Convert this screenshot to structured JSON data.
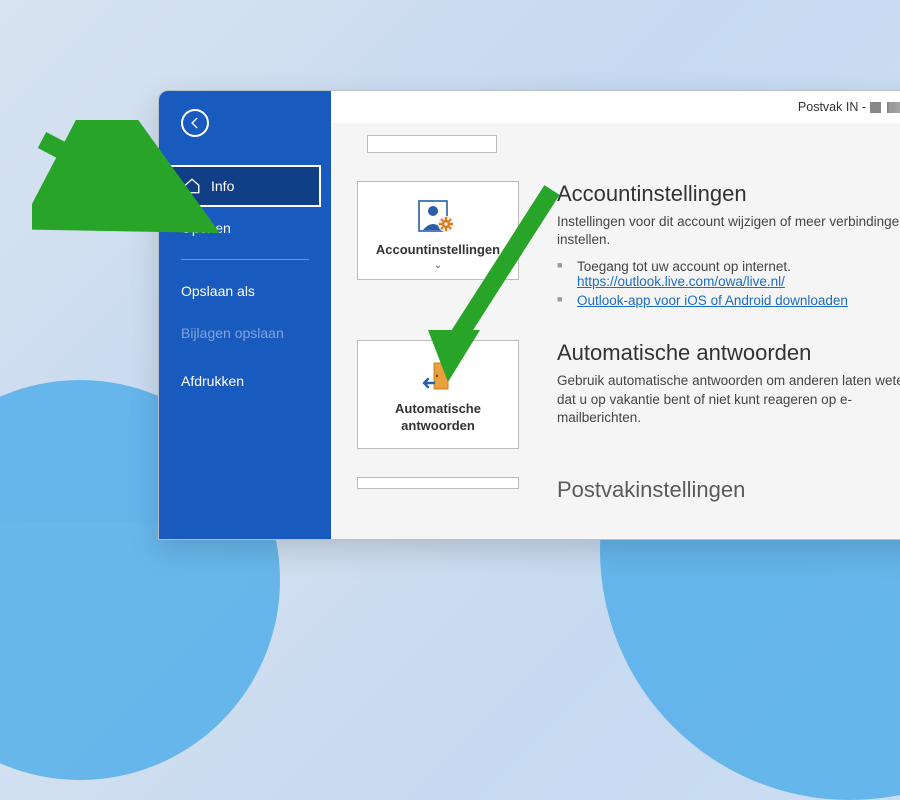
{
  "titlebar": {
    "label": "Postvak IN - "
  },
  "sidebar": {
    "items": [
      {
        "label": "Info"
      },
      {
        "label": "Openen"
      },
      {
        "label": "Opslaan als"
      },
      {
        "label": "Bijlagen opslaan"
      },
      {
        "label": "Afdrukken"
      }
    ]
  },
  "sections": [
    {
      "button_label": "Accountinstellingen",
      "heading": "Accountinstellingen",
      "text": "Instellingen voor dit account wijzigen of meer verbindingen instellen.",
      "bullets": [
        {
          "text": "Toegang tot uw account op internet.",
          "link": "https://outlook.live.com/owa/live.nl/"
        },
        {
          "text": "",
          "link": "Outlook-app voor iOS of Android downloaden"
        }
      ]
    },
    {
      "button_label": "Automatische antwoorden",
      "heading": "Automatische antwoorden",
      "text": "Gebruik automatische antwoorden om anderen laten weten dat u op vakantie bent of niet kunt reageren op e-mailberichten."
    },
    {
      "heading": "Postvakinstellingen"
    }
  ]
}
